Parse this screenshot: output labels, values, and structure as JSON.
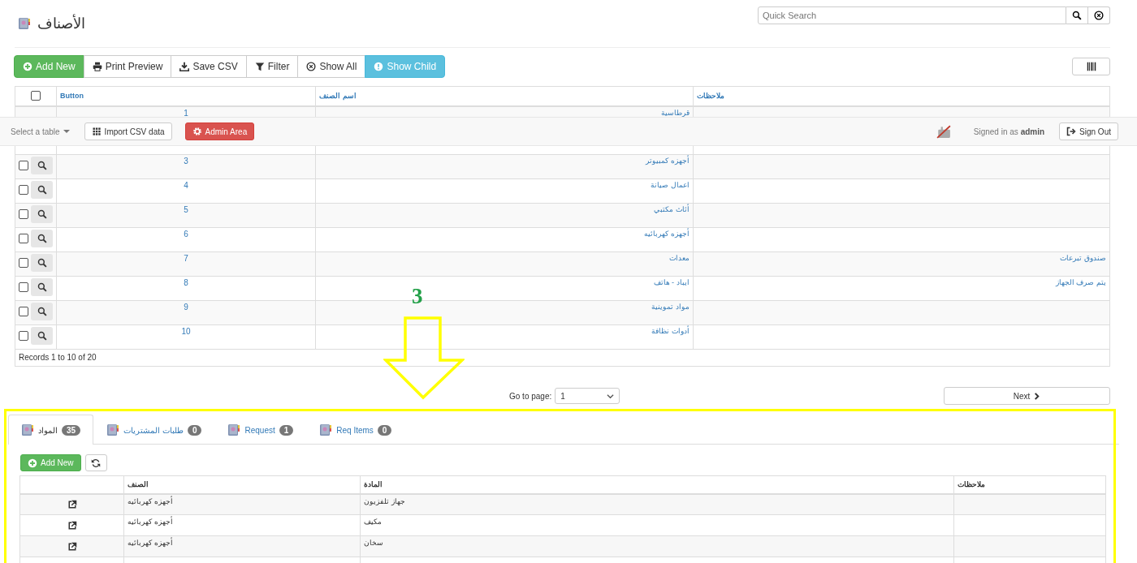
{
  "page_title": "الأصناف",
  "search": {
    "placeholder": "Quick Search"
  },
  "toolbar": [
    {
      "label": "Show Child",
      "kind": "info"
    },
    {
      "label": "Show All",
      "kind": "default"
    },
    {
      "label": "Filter",
      "kind": "default"
    },
    {
      "label": "Save CSV",
      "kind": "default"
    },
    {
      "label": "Print Preview",
      "kind": "default"
    },
    {
      "label": "Add New",
      "kind": "success"
    }
  ],
  "table": {
    "select_all_checked": false,
    "columns": [
      "ملاحظات",
      "اسم الصنف",
      "Button"
    ],
    "rows": [
      {
        "kind": "clipped",
        "button": "1",
        "name": "قرطاسية"
      },
      {
        "kind": "covered"
      },
      {
        "kind": "record",
        "checked": false,
        "button": "3",
        "name": "أجهزه كمبيوتر"
      },
      {
        "kind": "record",
        "checked": false,
        "button": "4",
        "name": "اعمال صيانة"
      },
      {
        "kind": "record",
        "checked": false,
        "button": "5",
        "name": "أثاث مكتبي"
      },
      {
        "kind": "record",
        "checked": false,
        "button": "6",
        "name": "أجهزه كهربائيه"
      },
      {
        "kind": "record",
        "checked": false,
        "button": "7",
        "name": "معدات",
        "notes": "صندوق تبرعات"
      },
      {
        "kind": "record",
        "checked": false,
        "button": "8",
        "name": "ايباد - هاتف",
        "notes": "يتم صرف الجهاز"
      },
      {
        "kind": "record",
        "checked": false,
        "button": "9",
        "name": "مواد تموينية"
      },
      {
        "kind": "record",
        "checked": false,
        "button": "10",
        "name": "أدوات نظافة"
      }
    ],
    "footer": "Records 1 to 10 of 20"
  },
  "navbar": {
    "table_select": "Select a table",
    "buttons": [
      {
        "label": "Admin Area",
        "kind": "danger"
      },
      {
        "label": "Import CSV data",
        "kind": "default"
      }
    ],
    "signed_in": "Signed in as ",
    "user": "admin",
    "sign_out": "Sign Out"
  },
  "pagination": {
    "label": "Go to page:",
    "page": "1",
    "next": "Next"
  },
  "annotation": {
    "label": "3"
  },
  "child_tabs": [
    {
      "label": "Req Items",
      "count": "0",
      "selected": false
    },
    {
      "label": "Request",
      "count": "1",
      "selected": false
    },
    {
      "label": "طلبات المشتريات",
      "count": "0",
      "selected": false
    },
    {
      "label": "المواد",
      "count": "35",
      "selected": true
    }
  ],
  "child": {
    "add_label": "Add New",
    "columns": [
      "ملاحظات",
      "المادة",
      "الصنف"
    ],
    "rows": [
      {
        "category": "أجهزه كهربائيه",
        "item": "جهاز تلفزيون"
      },
      {
        "category": "أجهزه كهربائيه",
        "item": "مكيف"
      },
      {
        "category": "أجهزه كهربائيه",
        "item": "سخان"
      }
    ]
  }
}
